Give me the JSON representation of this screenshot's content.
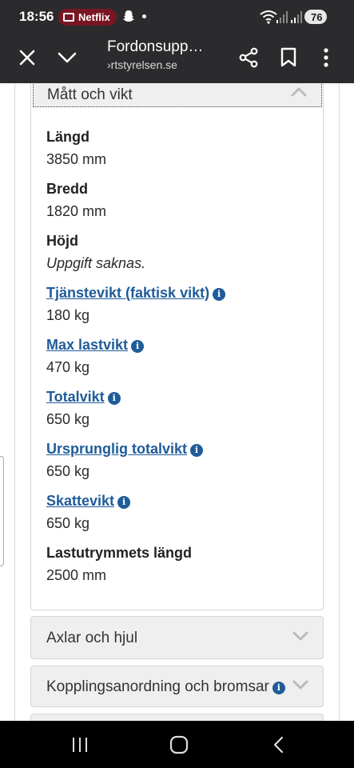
{
  "status_bar": {
    "time": "18:56",
    "notification_app": "Netflix",
    "battery": "76"
  },
  "browser": {
    "page_title": "Fordonsupp…",
    "url": "›rtstyrelsen.se"
  },
  "section": {
    "title": "Mått och vikt",
    "fields": [
      {
        "label": "Längd",
        "value": "3850 mm"
      },
      {
        "label": "Bredd",
        "value": "1820 mm"
      },
      {
        "label": "Höjd",
        "value": "Uppgift saknas."
      },
      {
        "label": "Tjänstevikt (faktisk vikt)",
        "value": "180 kg"
      },
      {
        "label": "Max lastvikt",
        "value": "470 kg"
      },
      {
        "label": "Totalvikt",
        "value": "650 kg"
      },
      {
        "label": "Ursprunglig totalvikt",
        "value": "650 kg"
      },
      {
        "label": "Skattevikt",
        "value": "650 kg"
      },
      {
        "label": "Lastutrymmets längd",
        "value": "2500 mm"
      }
    ]
  },
  "accordions": [
    {
      "label": "Axlar och hjul"
    },
    {
      "label": "Kopplingsanordning och bromsar"
    }
  ],
  "colors": {
    "link": "#1f5c99",
    "chrome": "#2b2b2e",
    "accordion_bg": "#efefef"
  },
  "icons": {
    "info": "i"
  }
}
